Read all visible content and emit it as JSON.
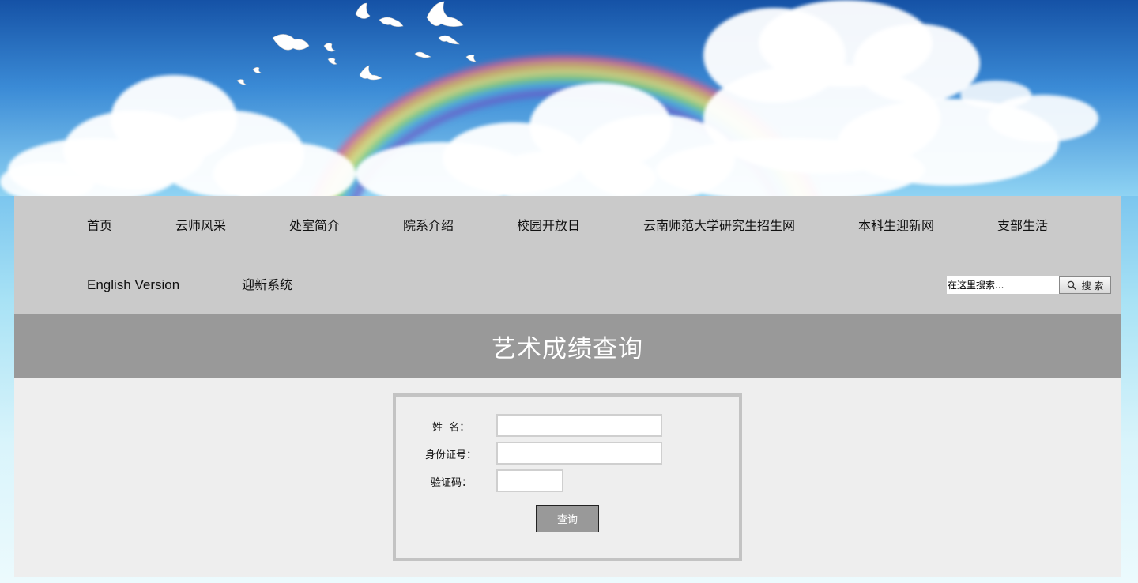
{
  "banner": {
    "alt": "蓝天白云彩虹白鸽横幅"
  },
  "nav": {
    "row1": [
      "首页",
      "云师风采",
      "处室简介",
      "院系介绍",
      "校园开放日",
      "云南师范大学研究生招生网",
      "本科生迎新网",
      "支部生活"
    ],
    "row2": [
      "English Version",
      "迎新系统"
    ],
    "search_placeholder": "在这里搜索...",
    "search_button_label": "搜 索",
    "search_icon": "magnifier-icon"
  },
  "page": {
    "title": "艺术成绩查询"
  },
  "form": {
    "name_label": "姓  名：",
    "id_label": "身份证号：",
    "captcha_label": "验证码：",
    "submit_label": "查询",
    "name_value": "",
    "id_value": "",
    "captcha_value": ""
  },
  "colors": {
    "nav_bg": "#cacaca",
    "title_bar_bg": "#999999",
    "content_bg": "#eeeeee",
    "form_border": "#c3c3c3",
    "button_bg": "#999999"
  }
}
